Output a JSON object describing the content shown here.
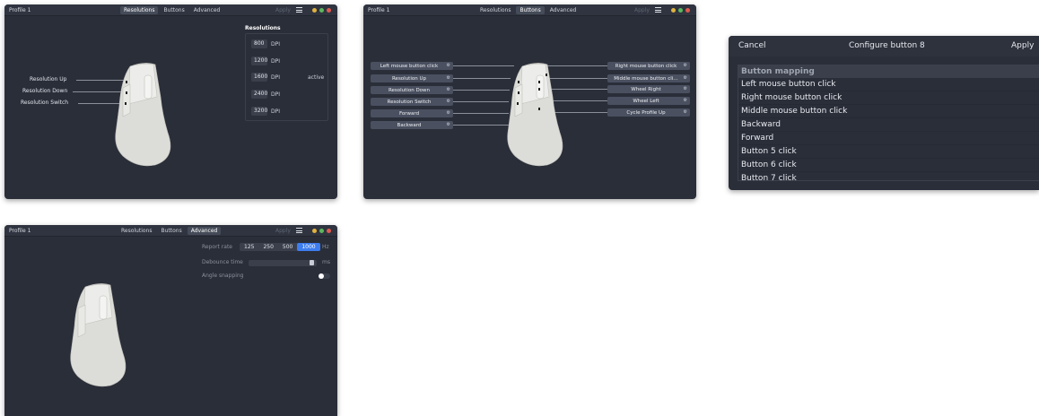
{
  "colors": {
    "window_bg": "#2a2e39",
    "titlebar_bg": "#2f3440",
    "accent": "#3d7df0",
    "dot_yellow": "#e0b340",
    "dot_green": "#5cb85c",
    "dot_red": "#e05a4f"
  },
  "titlebar": {
    "profile": "Profile 1",
    "tabs": [
      "Resolutions",
      "Buttons",
      "Advanced"
    ],
    "apply": "Apply",
    "menu_icon": "hamburger-icon"
  },
  "resolutions": {
    "title": "Resolutions",
    "rows": [
      {
        "value": "800",
        "unit": "DPI",
        "status": ""
      },
      {
        "value": "1200",
        "unit": "DPI",
        "status": ""
      },
      {
        "value": "1600",
        "unit": "DPI",
        "status": "active"
      },
      {
        "value": "2400",
        "unit": "DPI",
        "status": ""
      },
      {
        "value": "3200",
        "unit": "DPI",
        "status": ""
      }
    ],
    "callouts": [
      "Resolution Up",
      "Resolution Down",
      "Resolution Switch"
    ]
  },
  "buttons": {
    "left": [
      "Left mouse button click",
      "Resolution Up",
      "Resolution Down",
      "Resolution Switch",
      "Forward",
      "Backward"
    ],
    "right": [
      "Right mouse button click",
      "Middle mouse button cli…",
      "Wheel Right",
      "Wheel Left",
      "Cycle Profile Up"
    ],
    "gear_icon": "⚙"
  },
  "dialog": {
    "cancel": "Cancel",
    "title": "Configure button 8",
    "apply": "Apply",
    "list_header": "Button mapping",
    "items": [
      "Left mouse button click",
      "Right mouse button click",
      "Middle mouse button click",
      "Backward",
      "Forward",
      "Button 5 click",
      "Button 6 click",
      "Button 7 click"
    ]
  },
  "advanced": {
    "report_rate_label": "Report rate",
    "report_rates": [
      "125",
      "250",
      "500",
      "1000"
    ],
    "report_rate_selected": "1000",
    "report_rate_unit": "Hz",
    "debounce_label": "Debounce time",
    "debounce_unit": "ms",
    "angle_label": "Angle snapping",
    "angle_snapping": false
  }
}
